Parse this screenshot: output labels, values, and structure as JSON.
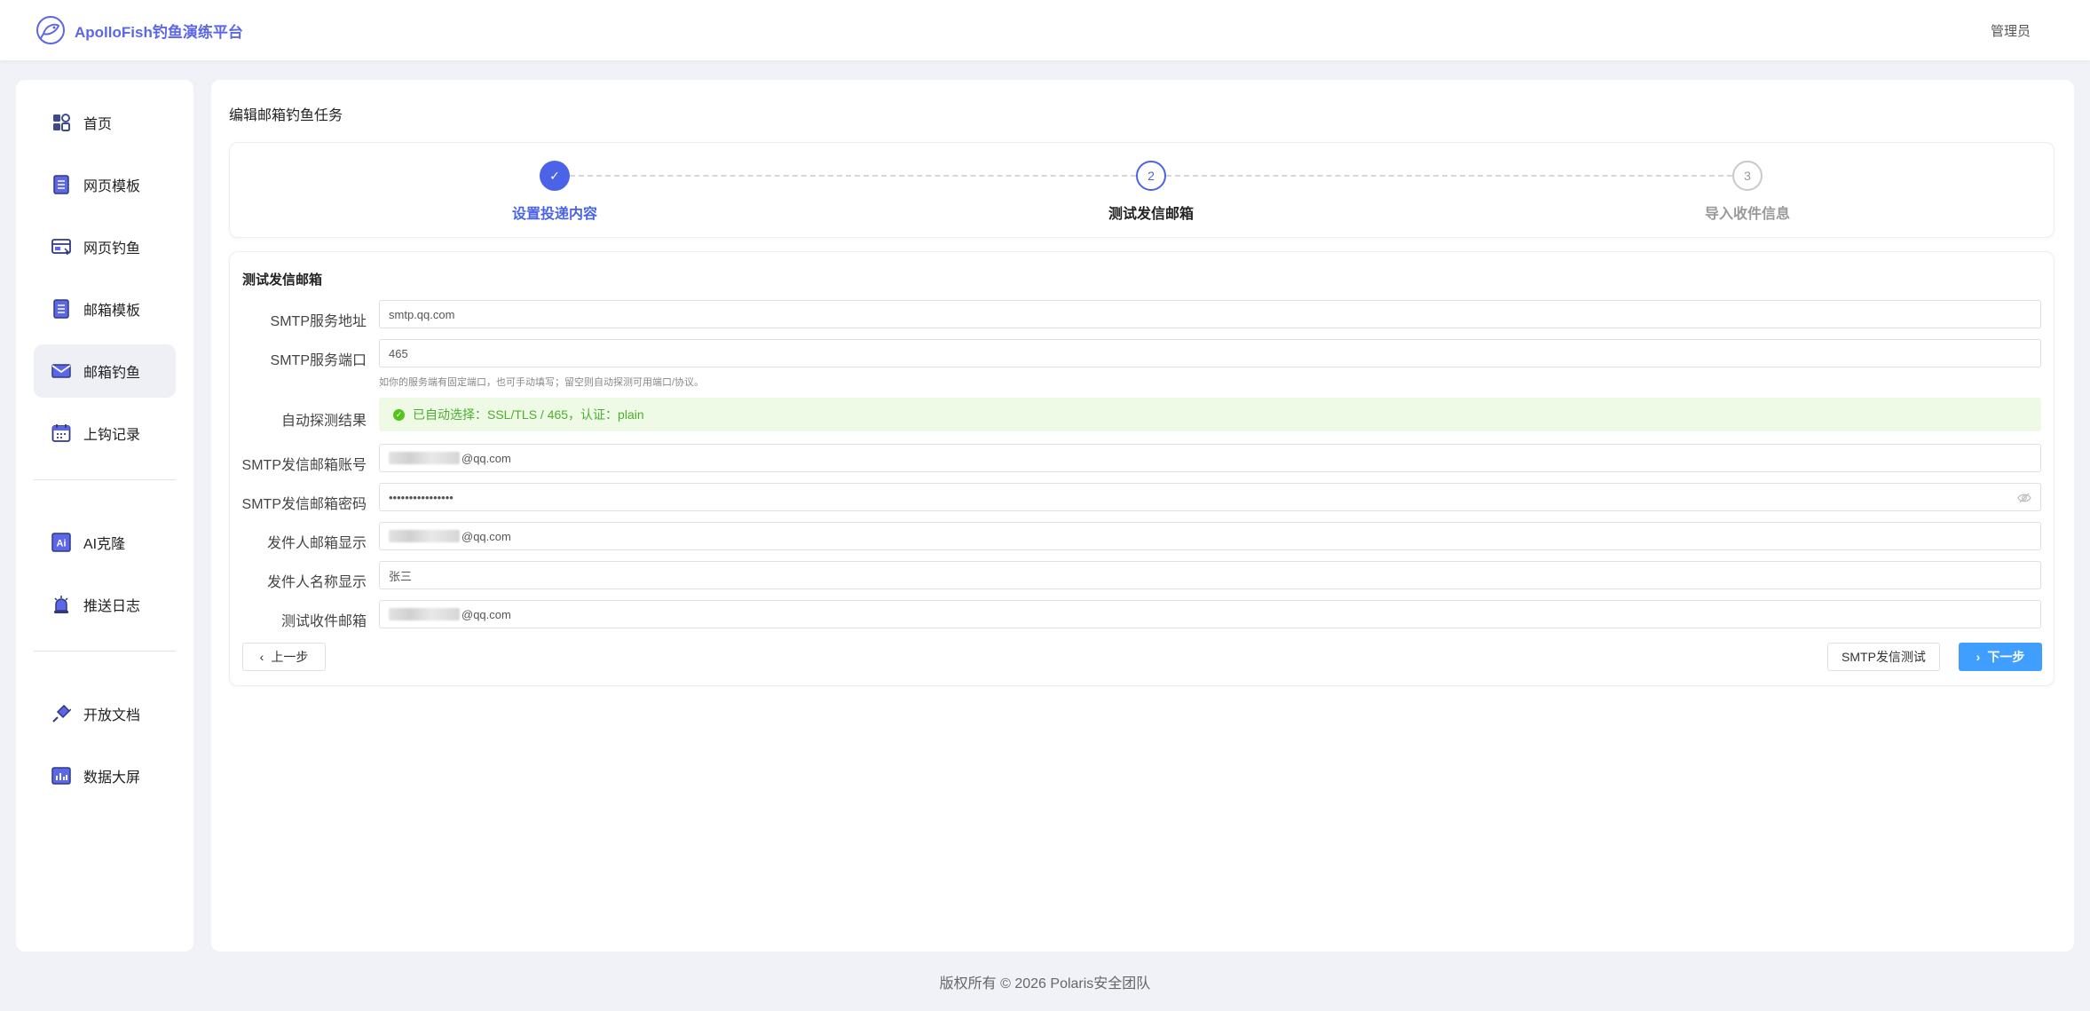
{
  "header": {
    "brand": "ApolloFish钓鱼演练平台",
    "user": "管理员",
    "accent": "#5b67e8"
  },
  "sidebar": {
    "group1": [
      {
        "label": "首页",
        "icon": "dashboard-icon"
      },
      {
        "label": "网页模板",
        "icon": "document-icon"
      },
      {
        "label": "网页钓鱼",
        "icon": "browser-icon"
      },
      {
        "label": "邮箱模板",
        "icon": "document-icon"
      },
      {
        "label": "邮箱钓鱼",
        "icon": "mail-icon",
        "active": true
      },
      {
        "label": "上钩记录",
        "icon": "calendar-icon"
      }
    ],
    "group2": [
      {
        "label": "AI克隆",
        "icon": "ai-icon"
      },
      {
        "label": "推送日志",
        "icon": "alarm-icon"
      }
    ],
    "group3": [
      {
        "label": "开放文档",
        "icon": "plug-icon"
      },
      {
        "label": "数据大屏",
        "icon": "chart-icon"
      }
    ]
  },
  "page": {
    "title": "编辑邮箱钓鱼任务"
  },
  "steps": [
    {
      "label": "设置投递内容",
      "status": "done",
      "number": "1"
    },
    {
      "label": "测试发信邮箱",
      "status": "current",
      "number": "2"
    },
    {
      "label": "导入收件信息",
      "status": "pending",
      "number": "3"
    }
  ],
  "form": {
    "title": "测试发信邮箱",
    "smtp_host_label": "SMTP服务地址",
    "smtp_host_value": "smtp.qq.com",
    "smtp_port_label": "SMTP服务端口",
    "smtp_port_value": "465",
    "smtp_port_hint": "如你的服务端有固定端口，也可手动填写；留空则自动探测可用端口/协议。",
    "detect_label": "自动探测结果",
    "detect_value": "已自动选择：SSL/TLS / 465，认证：plain",
    "account_label": "SMTP发信邮箱账号",
    "account_suffix": "@qq.com",
    "password_label": "SMTP发信邮箱密码",
    "password_value": "••••••••••••••••",
    "from_email_label": "发件人邮箱显示",
    "from_email_suffix": "@qq.com",
    "from_name_label": "发件人名称显示",
    "from_name_value": "张三",
    "test_to_label": "测试收件邮箱",
    "test_to_suffix": "@qq.com"
  },
  "buttons": {
    "prev": "上一步",
    "test": "SMTP发信测试",
    "next": "下一步"
  },
  "footer": "版权所有 © 2026 Polaris安全团队",
  "colors": {
    "primary": "#4a63e7",
    "next_button": "#409eff",
    "success_bg": "#eefae6",
    "success_text": "#4cae2e"
  }
}
